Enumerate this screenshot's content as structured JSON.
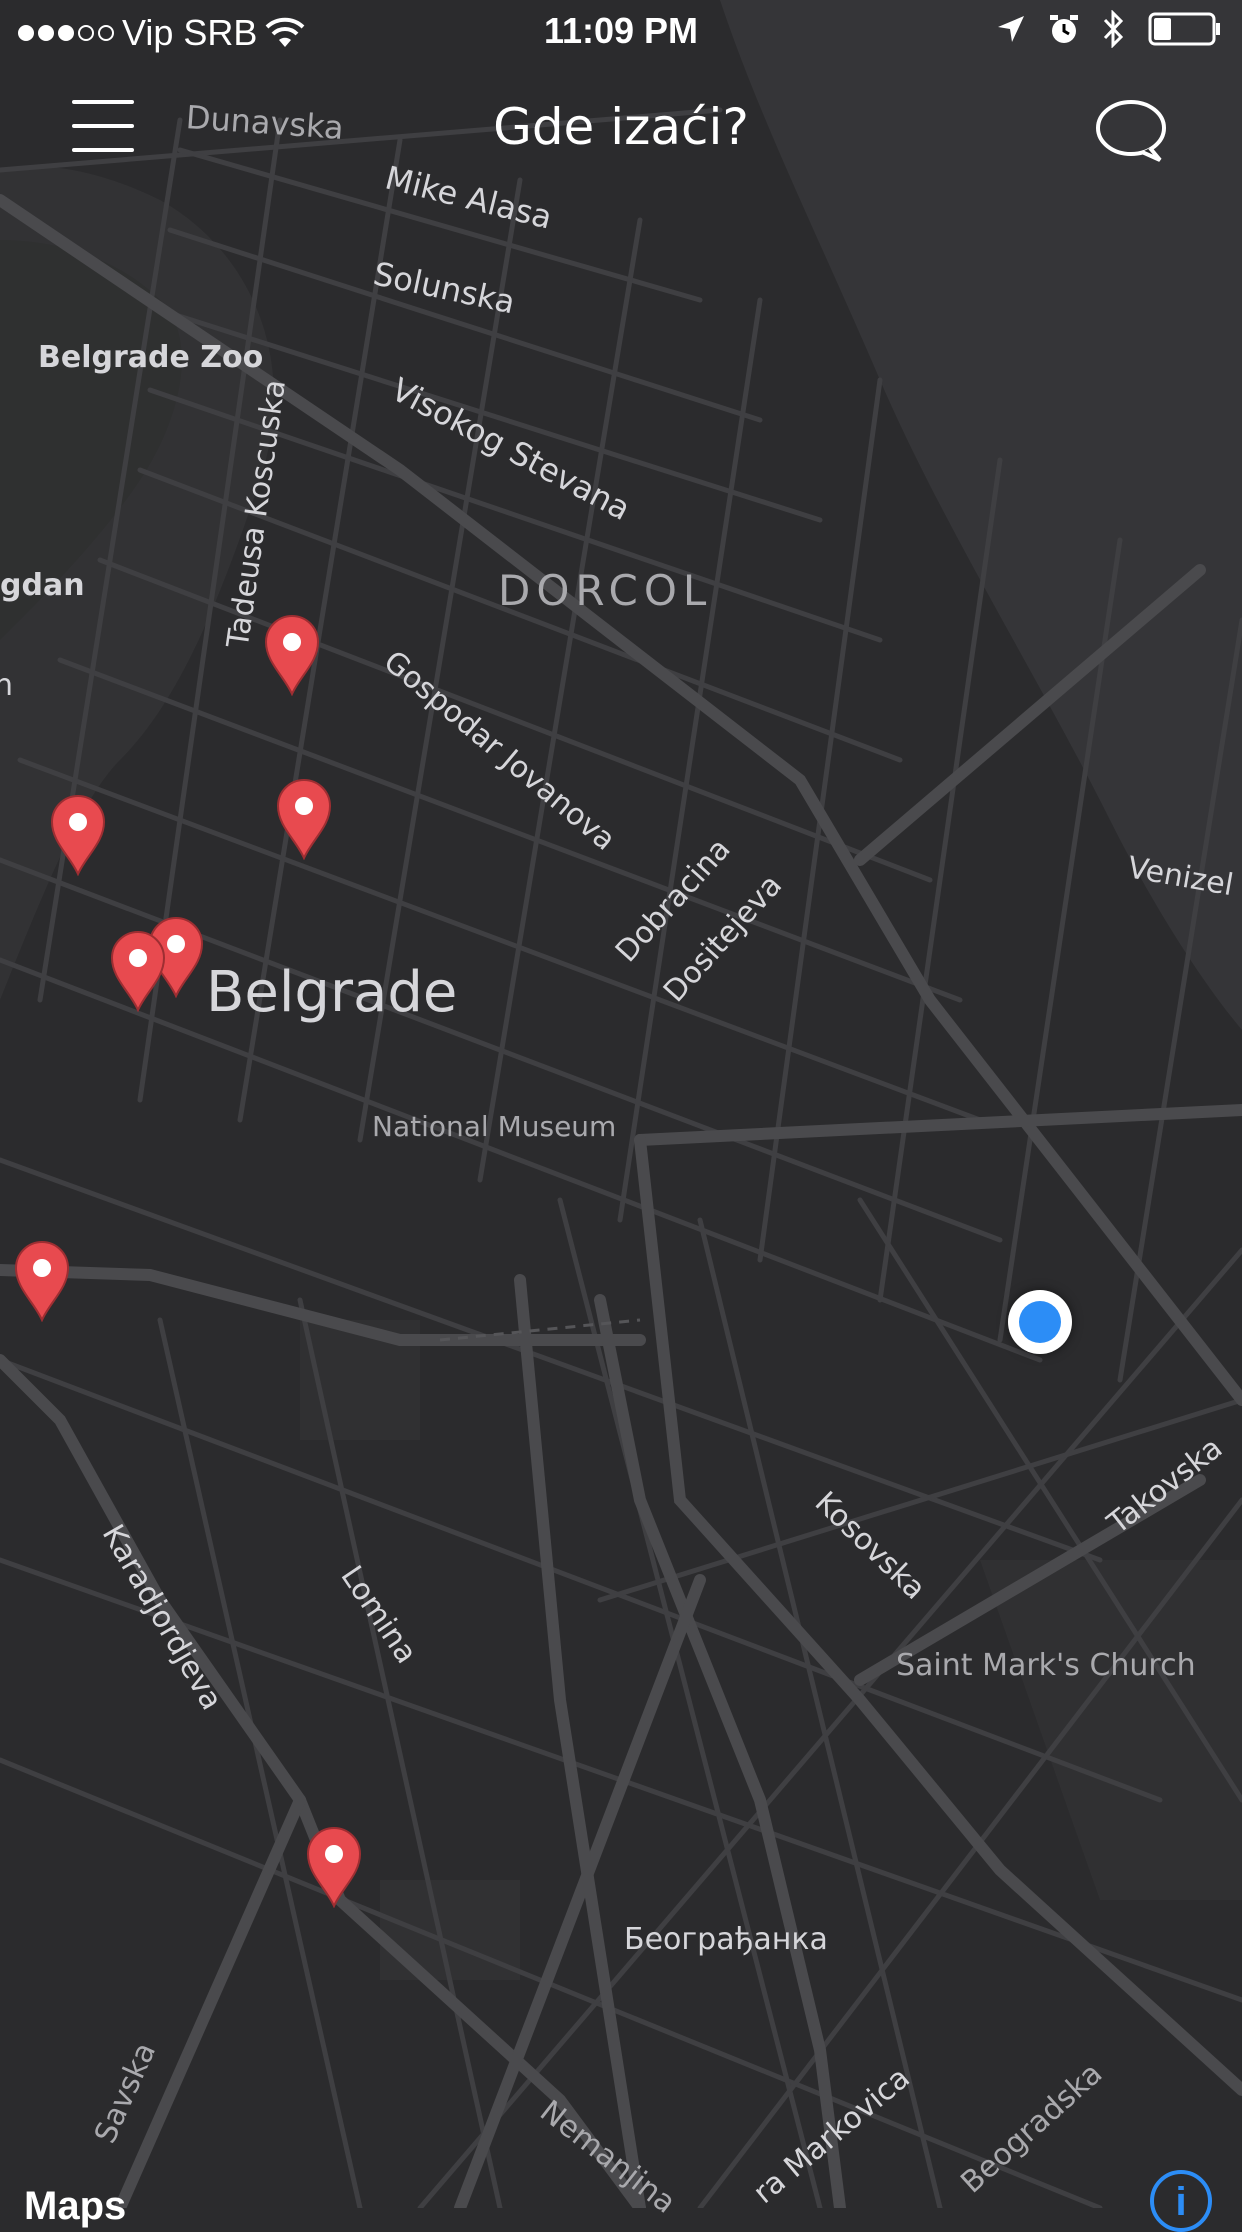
{
  "status_bar": {
    "carrier": "Vip SRB",
    "signal_bars_filled": 3,
    "signal_bars_total": 5,
    "time": "11:09 PM",
    "battery_level": 0.3
  },
  "nav": {
    "title": "Gde izaći?",
    "menu_icon": "hamburger-menu-icon",
    "chat_icon": "speech-bubble-icon"
  },
  "map": {
    "labels": {
      "dunavska": "Dunavska",
      "mike_alasa": "Mike Alasa",
      "solunska": "Solunska",
      "belgrade_zoo": "Belgrade Zoo",
      "visokog_stevana": "Visokog Stevana",
      "tadeusa_koscuska": "Tadeusa Koscuska",
      "dorcol": "DORCOL",
      "kalemegdan": "gdan",
      "gospodar_jovanova": "Gospodar Jovanova",
      "dobracina": "Dobracina",
      "dositejeva": "Dositejeva",
      "venizelosova": "Venizel",
      "belgrade": "Belgrade",
      "national_museum": "National Museum",
      "kosovska": "Kosovska",
      "takovska": "Takovska",
      "karadjordjeva": "Karadjordjeva",
      "lomina": "Lomina",
      "saint_marks_church": "Saint Mark's Church",
      "beogradjanka": "Београђанка",
      "savska": "Savska",
      "nemanjina": "Nemanjina",
      "kralja_milana": "ra Markovica",
      "beogradska": "Beogradska",
      "left_edge_n": "n"
    },
    "pin_color": "#e84a4f",
    "user_location_color": "#2c8df6",
    "venue_pin_count": 8,
    "legal": "Maps",
    "info_icon": "info-icon"
  }
}
